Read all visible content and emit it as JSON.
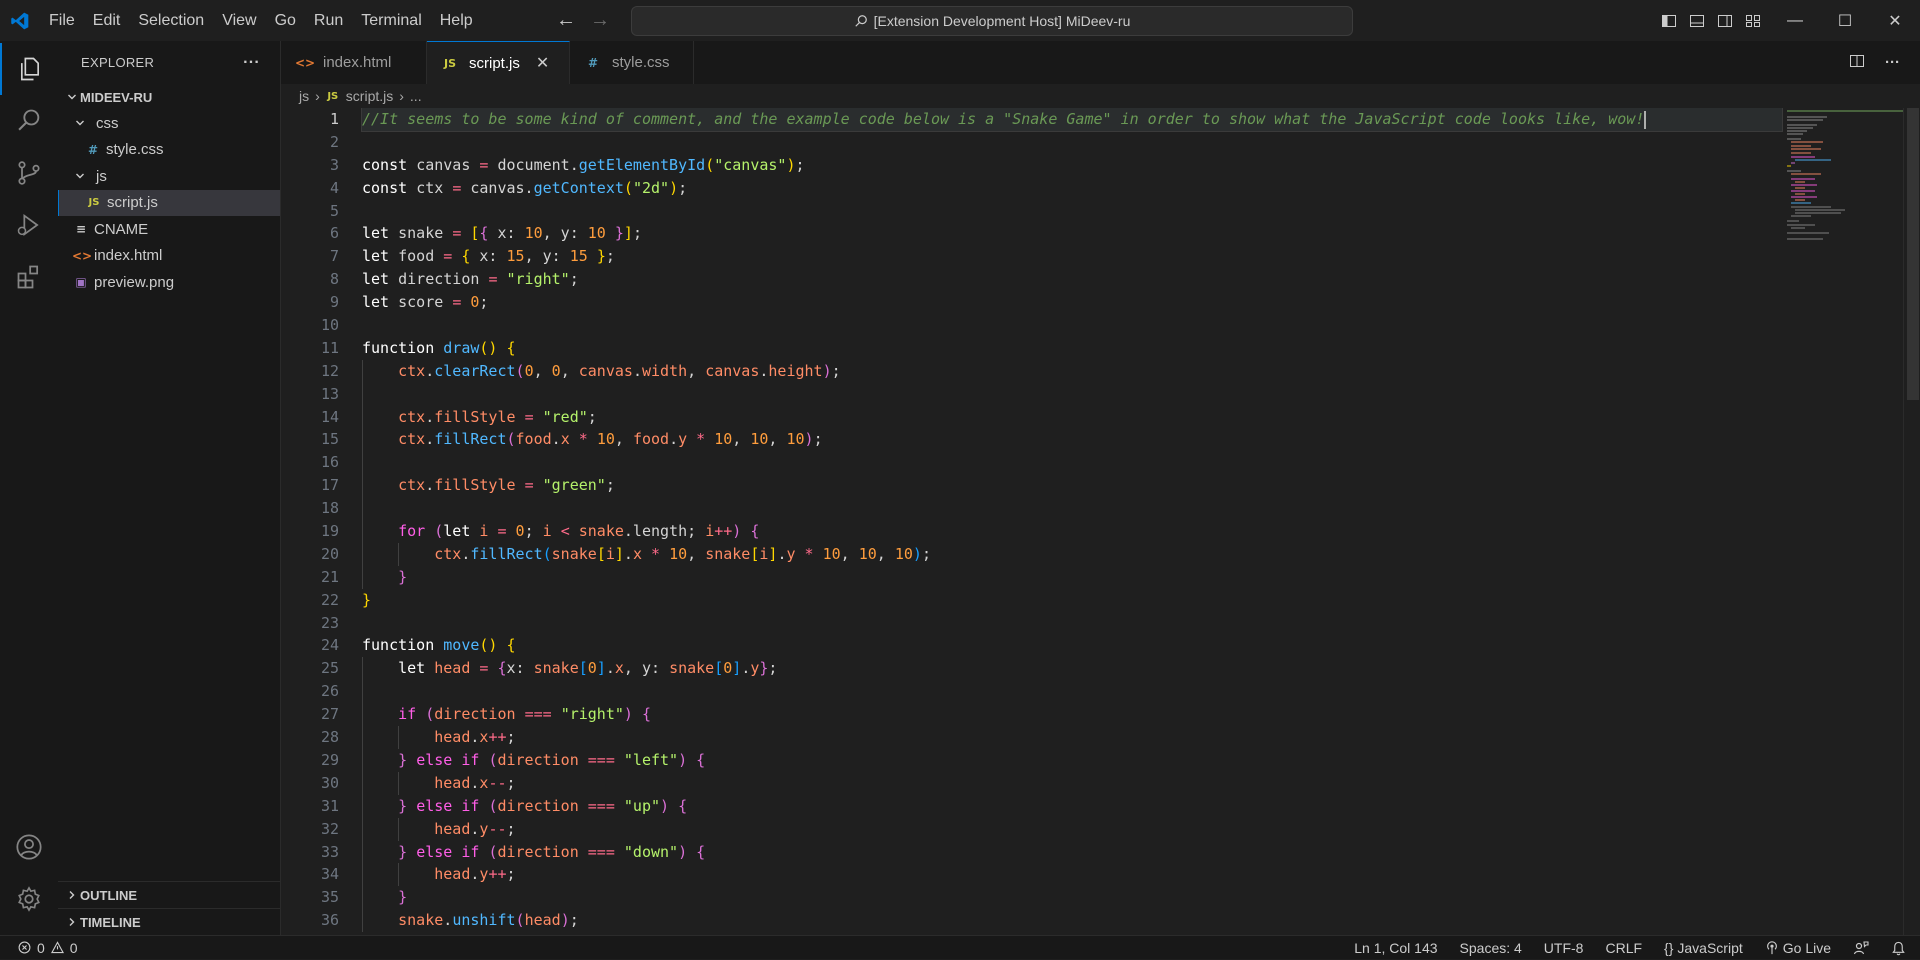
{
  "titlebar": {
    "menu": [
      "File",
      "Edit",
      "Selection",
      "View",
      "Go",
      "Run",
      "Terminal",
      "Help"
    ],
    "search_text": "[Extension Development Host] MiDeev-ru",
    "logo_color": "#0078d4"
  },
  "sidebar": {
    "header": "EXPLORER",
    "more_label": "···",
    "root": "MIDEEV-RU",
    "tree": [
      {
        "label": "css",
        "kind": "folder",
        "depth": 1
      },
      {
        "label": "style.css",
        "kind": "css",
        "depth": 2
      },
      {
        "label": "js",
        "kind": "folder",
        "depth": 1
      },
      {
        "label": "script.js",
        "kind": "js",
        "depth": 2,
        "selected": true
      },
      {
        "label": "CNAME",
        "kind": "text",
        "depth": 1
      },
      {
        "label": "index.html",
        "kind": "html",
        "depth": 1
      },
      {
        "label": "preview.png",
        "kind": "image",
        "depth": 1
      }
    ],
    "outline": "OUTLINE",
    "timeline": "TIMELINE"
  },
  "tabs": [
    {
      "label": "index.html",
      "kind": "html",
      "active": false
    },
    {
      "label": "script.js",
      "kind": "js",
      "active": true
    },
    {
      "label": "style.css",
      "kind": "css",
      "active": false
    }
  ],
  "breadcrumb": {
    "folder": "js",
    "file": "script.js",
    "symbol": "..."
  },
  "editor": {
    "language": "JavaScript",
    "lines": [
      [
        [
          "c-com",
          "//It seems to be some kind of comment, and the example code below is a \"Snake Game\" in order to show what the JavaScript code looks like, wow!"
        ]
      ],
      [],
      [
        [
          "c-kw",
          "const "
        ],
        [
          "c-def",
          "canvas "
        ],
        [
          "c-op",
          "= "
        ],
        [
          "c-def",
          "document."
        ],
        [
          "c-fn",
          "getElementById"
        ],
        [
          "c-p1",
          "("
        ],
        [
          "c-str",
          "\"canvas\""
        ],
        [
          "c-p1",
          ")"
        ],
        [
          "c-def",
          ";"
        ]
      ],
      [
        [
          "c-kw",
          "const "
        ],
        [
          "c-def",
          "ctx "
        ],
        [
          "c-op",
          "= "
        ],
        [
          "c-def",
          "canvas."
        ],
        [
          "c-fn",
          "getContext"
        ],
        [
          "c-p1",
          "("
        ],
        [
          "c-str",
          "\"2d\""
        ],
        [
          "c-p1",
          ")"
        ],
        [
          "c-def",
          ";"
        ]
      ],
      [],
      [
        [
          "c-kw",
          "let "
        ],
        [
          "c-def",
          "snake "
        ],
        [
          "c-op",
          "= "
        ],
        [
          "c-p1",
          "["
        ],
        [
          "c-p2",
          "{ "
        ],
        [
          "c-def",
          "x: "
        ],
        [
          "c-num",
          "10"
        ],
        [
          "c-def",
          ", y: "
        ],
        [
          "c-num",
          "10 "
        ],
        [
          "c-p2",
          "}"
        ],
        [
          "c-p1",
          "]"
        ],
        [
          "c-def",
          ";"
        ]
      ],
      [
        [
          "c-kw",
          "let "
        ],
        [
          "c-def",
          "food "
        ],
        [
          "c-op",
          "= "
        ],
        [
          "c-p1",
          "{ "
        ],
        [
          "c-def",
          "x: "
        ],
        [
          "c-num",
          "15"
        ],
        [
          "c-def",
          ", y: "
        ],
        [
          "c-num",
          "15 "
        ],
        [
          "c-p1",
          "}"
        ],
        [
          "c-def",
          ";"
        ]
      ],
      [
        [
          "c-kw",
          "let "
        ],
        [
          "c-def",
          "direction "
        ],
        [
          "c-op",
          "= "
        ],
        [
          "c-str",
          "\"right\""
        ],
        [
          "c-def",
          ";"
        ]
      ],
      [
        [
          "c-kw",
          "let "
        ],
        [
          "c-def",
          "score "
        ],
        [
          "c-op",
          "= "
        ],
        [
          "c-num",
          "0"
        ],
        [
          "c-def",
          ";"
        ]
      ],
      [],
      [
        [
          "c-kw",
          "function "
        ],
        [
          "c-fn",
          "draw"
        ],
        [
          "c-p1",
          "() {"
        ]
      ],
      [
        [
          "c-def",
          "    "
        ],
        [
          "c-var",
          "ctx"
        ],
        [
          "c-def",
          "."
        ],
        [
          "c-fn",
          "clearRect"
        ],
        [
          "c-p2",
          "("
        ],
        [
          "c-num",
          "0"
        ],
        [
          "c-def",
          ", "
        ],
        [
          "c-num",
          "0"
        ],
        [
          "c-def",
          ", "
        ],
        [
          "c-var",
          "canvas"
        ],
        [
          "c-def",
          "."
        ],
        [
          "c-prop",
          "width"
        ],
        [
          "c-def",
          ", "
        ],
        [
          "c-var",
          "canvas"
        ],
        [
          "c-def",
          "."
        ],
        [
          "c-prop",
          "height"
        ],
        [
          "c-p2",
          ")"
        ],
        [
          "c-def",
          ";"
        ]
      ],
      [],
      [
        [
          "c-def",
          "    "
        ],
        [
          "c-var",
          "ctx"
        ],
        [
          "c-def",
          "."
        ],
        [
          "c-prop",
          "fillStyle "
        ],
        [
          "c-op",
          "= "
        ],
        [
          "c-str",
          "\"red\""
        ],
        [
          "c-def",
          ";"
        ]
      ],
      [
        [
          "c-def",
          "    "
        ],
        [
          "c-var",
          "ctx"
        ],
        [
          "c-def",
          "."
        ],
        [
          "c-fn",
          "fillRect"
        ],
        [
          "c-p2",
          "("
        ],
        [
          "c-var",
          "food"
        ],
        [
          "c-def",
          "."
        ],
        [
          "c-prop",
          "x "
        ],
        [
          "c-op",
          "* "
        ],
        [
          "c-num",
          "10"
        ],
        [
          "c-def",
          ", "
        ],
        [
          "c-var",
          "food"
        ],
        [
          "c-def",
          "."
        ],
        [
          "c-prop",
          "y "
        ],
        [
          "c-op",
          "* "
        ],
        [
          "c-num",
          "10"
        ],
        [
          "c-def",
          ", "
        ],
        [
          "c-num",
          "10"
        ],
        [
          "c-def",
          ", "
        ],
        [
          "c-num",
          "10"
        ],
        [
          "c-p2",
          ")"
        ],
        [
          "c-def",
          ";"
        ]
      ],
      [],
      [
        [
          "c-def",
          "    "
        ],
        [
          "c-var",
          "ctx"
        ],
        [
          "c-def",
          "."
        ],
        [
          "c-prop",
          "fillStyle "
        ],
        [
          "c-op",
          "= "
        ],
        [
          "c-str",
          "\"green\""
        ],
        [
          "c-def",
          ";"
        ]
      ],
      [],
      [
        [
          "c-def",
          "    "
        ],
        [
          "c-ctl",
          "for "
        ],
        [
          "c-p2",
          "("
        ],
        [
          "c-kw",
          "let "
        ],
        [
          "c-var",
          "i "
        ],
        [
          "c-op",
          "= "
        ],
        [
          "c-num",
          "0"
        ],
        [
          "c-def",
          "; "
        ],
        [
          "c-var",
          "i "
        ],
        [
          "c-op",
          "< "
        ],
        [
          "c-var",
          "snake"
        ],
        [
          "c-def",
          ".length; "
        ],
        [
          "c-var",
          "i"
        ],
        [
          "c-op",
          "++"
        ],
        [
          "c-p2",
          ") {"
        ]
      ],
      [
        [
          "c-def",
          "        "
        ],
        [
          "c-var",
          "ctx"
        ],
        [
          "c-def",
          "."
        ],
        [
          "c-fn",
          "fillRect"
        ],
        [
          "c-p3",
          "("
        ],
        [
          "c-var",
          "snake"
        ],
        [
          "c-p1",
          "["
        ],
        [
          "c-var",
          "i"
        ],
        [
          "c-p1",
          "]"
        ],
        [
          "c-def",
          "."
        ],
        [
          "c-prop",
          "x "
        ],
        [
          "c-op",
          "* "
        ],
        [
          "c-num",
          "10"
        ],
        [
          "c-def",
          ", "
        ],
        [
          "c-var",
          "snake"
        ],
        [
          "c-p1",
          "["
        ],
        [
          "c-var",
          "i"
        ],
        [
          "c-p1",
          "]"
        ],
        [
          "c-def",
          "."
        ],
        [
          "c-prop",
          "y "
        ],
        [
          "c-op",
          "* "
        ],
        [
          "c-num",
          "10"
        ],
        [
          "c-def",
          ", "
        ],
        [
          "c-num",
          "10"
        ],
        [
          "c-def",
          ", "
        ],
        [
          "c-num",
          "10"
        ],
        [
          "c-p3",
          ")"
        ],
        [
          "c-def",
          ";"
        ]
      ],
      [
        [
          "c-def",
          "    "
        ],
        [
          "c-p2",
          "}"
        ]
      ],
      [
        [
          "c-p1",
          "}"
        ]
      ],
      [],
      [
        [
          "c-kw",
          "function "
        ],
        [
          "c-fn",
          "move"
        ],
        [
          "c-p1",
          "() {"
        ]
      ],
      [
        [
          "c-def",
          "    "
        ],
        [
          "c-kw",
          "let "
        ],
        [
          "c-var",
          "head "
        ],
        [
          "c-op",
          "= "
        ],
        [
          "c-p2",
          "{"
        ],
        [
          "c-def",
          "x: "
        ],
        [
          "c-var",
          "snake"
        ],
        [
          "c-p3",
          "["
        ],
        [
          "c-num",
          "0"
        ],
        [
          "c-p3",
          "]"
        ],
        [
          "c-def",
          "."
        ],
        [
          "c-prop",
          "x"
        ],
        [
          "c-def",
          ", y: "
        ],
        [
          "c-var",
          "snake"
        ],
        [
          "c-p3",
          "["
        ],
        [
          "c-num",
          "0"
        ],
        [
          "c-p3",
          "]"
        ],
        [
          "c-def",
          "."
        ],
        [
          "c-prop",
          "y"
        ],
        [
          "c-p2",
          "}"
        ],
        [
          "c-def",
          ";"
        ]
      ],
      [],
      [
        [
          "c-def",
          "    "
        ],
        [
          "c-ctl",
          "if "
        ],
        [
          "c-p2",
          "("
        ],
        [
          "c-var",
          "direction "
        ],
        [
          "c-op",
          "=== "
        ],
        [
          "c-str",
          "\"right\""
        ],
        [
          "c-p2",
          ") {"
        ]
      ],
      [
        [
          "c-def",
          "        "
        ],
        [
          "c-var",
          "head"
        ],
        [
          "c-def",
          "."
        ],
        [
          "c-prop",
          "x"
        ],
        [
          "c-op",
          "++"
        ],
        [
          "c-def",
          ";"
        ]
      ],
      [
        [
          "c-def",
          "    "
        ],
        [
          "c-p2",
          "} "
        ],
        [
          "c-ctl",
          "else if "
        ],
        [
          "c-p2",
          "("
        ],
        [
          "c-var",
          "direction "
        ],
        [
          "c-op",
          "=== "
        ],
        [
          "c-str",
          "\"left\""
        ],
        [
          "c-p2",
          ") {"
        ]
      ],
      [
        [
          "c-def",
          "        "
        ],
        [
          "c-var",
          "head"
        ],
        [
          "c-def",
          "."
        ],
        [
          "c-prop",
          "x"
        ],
        [
          "c-op",
          "--"
        ],
        [
          "c-def",
          ";"
        ]
      ],
      [
        [
          "c-def",
          "    "
        ],
        [
          "c-p2",
          "} "
        ],
        [
          "c-ctl",
          "else if "
        ],
        [
          "c-p2",
          "("
        ],
        [
          "c-var",
          "direction "
        ],
        [
          "c-op",
          "=== "
        ],
        [
          "c-str",
          "\"up\""
        ],
        [
          "c-p2",
          ") {"
        ]
      ],
      [
        [
          "c-def",
          "        "
        ],
        [
          "c-var",
          "head"
        ],
        [
          "c-def",
          "."
        ],
        [
          "c-prop",
          "y"
        ],
        [
          "c-op",
          "--"
        ],
        [
          "c-def",
          ";"
        ]
      ],
      [
        [
          "c-def",
          "    "
        ],
        [
          "c-p2",
          "} "
        ],
        [
          "c-ctl",
          "else if "
        ],
        [
          "c-p2",
          "("
        ],
        [
          "c-var",
          "direction "
        ],
        [
          "c-op",
          "=== "
        ],
        [
          "c-str",
          "\"down\""
        ],
        [
          "c-p2",
          ") {"
        ]
      ],
      [
        [
          "c-def",
          "        "
        ],
        [
          "c-var",
          "head"
        ],
        [
          "c-def",
          "."
        ],
        [
          "c-prop",
          "y"
        ],
        [
          "c-op",
          "++"
        ],
        [
          "c-def",
          ";"
        ]
      ],
      [
        [
          "c-def",
          "    "
        ],
        [
          "c-p2",
          "}"
        ]
      ],
      [
        [
          "c-def",
          "    "
        ],
        [
          "c-var",
          "snake"
        ],
        [
          "c-def",
          "."
        ],
        [
          "c-fn",
          "unshift"
        ],
        [
          "c-p2",
          "("
        ],
        [
          "c-var",
          "head"
        ],
        [
          "c-p2",
          ")"
        ],
        [
          "c-def",
          ";"
        ]
      ]
    ]
  },
  "statusbar": {
    "errors": "0",
    "warnings": "0",
    "position": "Ln 1, Col 143",
    "spaces": "Spaces: 4",
    "encoding": "UTF-8",
    "eol": "CRLF",
    "language": "JavaScript",
    "golive": "Go Live"
  }
}
